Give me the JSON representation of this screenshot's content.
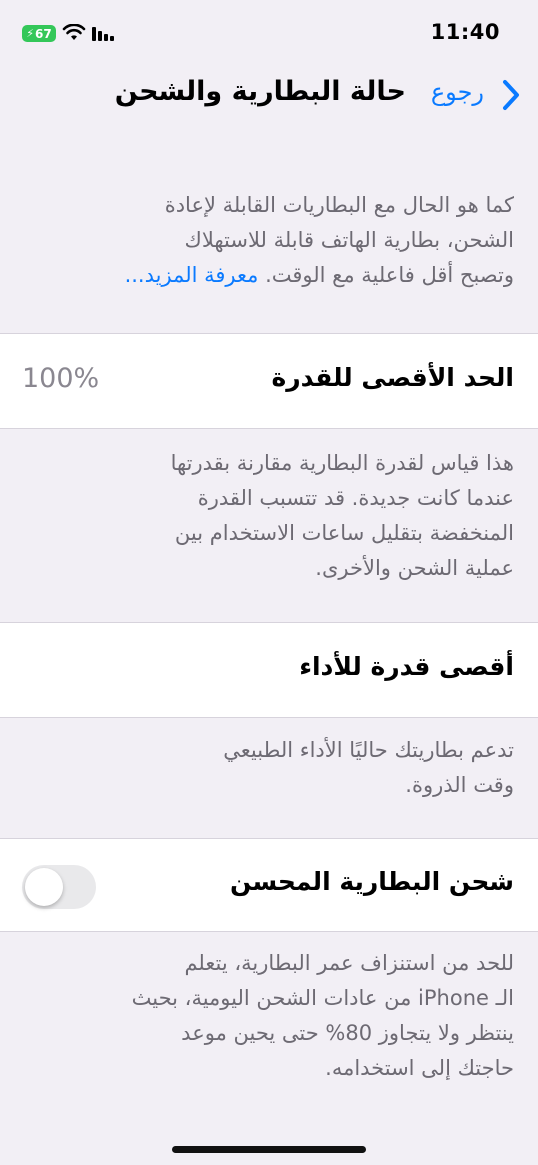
{
  "status_bar": {
    "time": "11:40",
    "battery_level": "67",
    "battery_color": "#34c759"
  },
  "nav": {
    "back_label": "رجوع",
    "title": "حالة البطارية والشحن"
  },
  "intro": {
    "lines": [
      "كما هو الحال مع البطاريات القابلة لإعادة",
      "الشحن، بطارية الهاتف قابلة للاستهلاك",
      "وتصبح أقل فاعلية مع الوقت."
    ],
    "learn_more": "معرفة المزيد..."
  },
  "max_capacity": {
    "label": "الحد الأقصى للقدرة",
    "value": "100%",
    "description_lines": [
      "هذا قياس لقدرة البطارية مقارنة بقدرتها",
      "عندما كانت جديدة. قد تتسبب القدرة",
      "المنخفضة بتقليل ساعات الاستخدام بين",
      "عملية الشحن والأخرى."
    ]
  },
  "peak_performance": {
    "label": "أقصى قدرة للأداء",
    "description_lines": [
      "تدعم بطاريتك حاليًا الأداء الطبيعي",
      "وقت الذروة."
    ]
  },
  "optimized_charging": {
    "label": "شحن البطارية المحسن",
    "enabled": false,
    "description_lines": [
      "للحد من استنزاف عمر البطارية، يتعلم",
      "الـ iPhone من عادات الشحن اليومية، بحيث",
      "ينتظر ولا يتجاوز 80% حتى يحين موعد",
      "حاجتك إلى استخدامه."
    ]
  },
  "accent_color": "#0a7aff"
}
